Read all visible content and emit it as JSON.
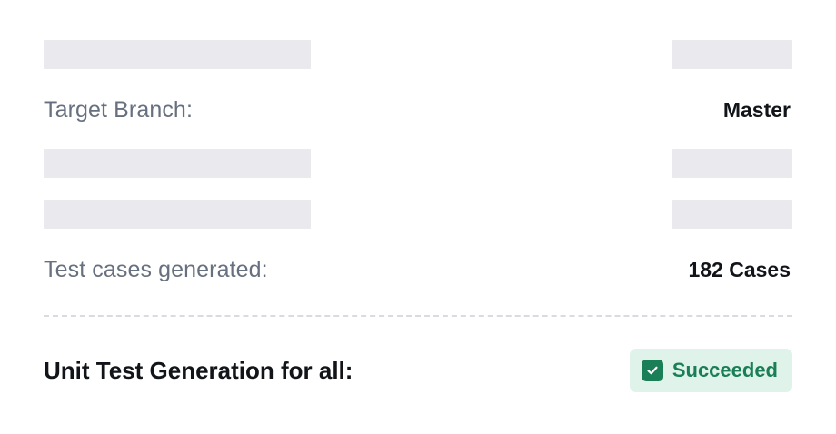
{
  "details": {
    "target_branch_label": "Target Branch:",
    "target_branch_value": "Master",
    "test_cases_label": "Test cases generated:",
    "test_cases_value": "182 Cases"
  },
  "footer": {
    "title": "Unit Test Generation for all:",
    "status": "Succeeded",
    "status_icon": "check-icon",
    "status_color": "#1a7f57",
    "status_bg": "#e0f3ea"
  },
  "skeleton_color": "#e9e9ee"
}
